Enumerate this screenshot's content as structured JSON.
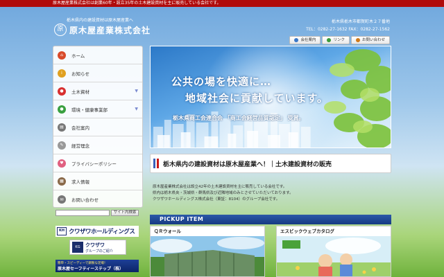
{
  "topbar": {
    "text": "原木屋産業株式会社は創業60年・設立35年の土木建設資材を主に販売している会社です。"
  },
  "header": {
    "tagline": "栃木県内の建設資材は原木屋産業へ",
    "logo_mark": "原",
    "company_name": "原木屋産業株式会社",
    "address": "栃木県栃木市都賀町木２７番地",
    "phone": "TEL：0282-27-1632 FAX：0282-27-1562",
    "links": [
      {
        "label": "会社案内",
        "icon": "building-icon",
        "color": "#3a78c8"
      },
      {
        "label": "リンク",
        "icon": "link-icon",
        "color": "#3a9a3a"
      },
      {
        "label": "お問い合わせ",
        "icon": "mail-icon",
        "color": "#d07a1a"
      }
    ]
  },
  "sidebar": {
    "items": [
      {
        "label": "ホーム",
        "icon": "home-icon",
        "color": "#d84a2a",
        "glyph": "⌂",
        "chevron": false
      },
      {
        "label": "お知らせ",
        "icon": "info-icon",
        "color": "#e0a020",
        "glyph": "i",
        "chevron": false
      },
      {
        "label": "土木資材",
        "icon": "material-icon",
        "color": "#d83030",
        "glyph": "●",
        "chevron": true
      },
      {
        "label": "環境・健康事業部",
        "icon": "leaf-icon",
        "color": "#3aa040",
        "glyph": "●",
        "chevron": true
      },
      {
        "label": "会社案内",
        "icon": "document-icon",
        "color": "#777777",
        "glyph": "▤",
        "chevron": false
      },
      {
        "label": "経営理念",
        "icon": "pen-icon",
        "color": "#999999",
        "glyph": "✎",
        "chevron": false
      },
      {
        "label": "プライバシーポリシー",
        "icon": "heart-icon",
        "color": "#e06080",
        "glyph": "♥",
        "chevron": false
      },
      {
        "label": "求人情報",
        "icon": "notepad-icon",
        "color": "#8a6a4a",
        "glyph": "▦",
        "chevron": false
      },
      {
        "label": "お問い合わせ",
        "icon": "envelope-icon",
        "color": "#777777",
        "glyph": "✉",
        "chevron": false
      }
    ]
  },
  "search": {
    "button_label": "サイト内検索",
    "value": ""
  },
  "banners": {
    "kurosawa_holdings": {
      "mark": "KH",
      "text": "クワザワホールディングス"
    },
    "kurosawa_group": {
      "mark": "KG",
      "line1": "クワザワ",
      "line2": "グループのご紹介"
    },
    "safety_step": {
      "line1": "簡単・スピーディーで鋼製な足場！",
      "line2": "原木屋セーフティーステップ（株）"
    }
  },
  "hero": {
    "line1": "公共の場を快適に…",
    "line2": "地域社会に貢献しています。",
    "certification": "栃木県商工会連合会 「商工会経営品質認定」 受賞。"
  },
  "headline": {
    "text": "栃木県内の建設資材は原木屋産業へ！｜土木建設資材の販売"
  },
  "intro": {
    "lines": [
      "原木屋産業株式会社は設立42年の土木建設資材を主に販売している会社です。",
      "県内は栃木県央・茨城県・群馬県及び近隣地域のみとさせていただいております。",
      "クワザワホールディングス株式会社（東証：8104）のグループ会社です。"
    ]
  },
  "pickup": {
    "title": "PICKUP ITEM",
    "cards": [
      {
        "title": "ＱＲウォール"
      },
      {
        "title": "エスビックウェブカタログ"
      }
    ]
  }
}
